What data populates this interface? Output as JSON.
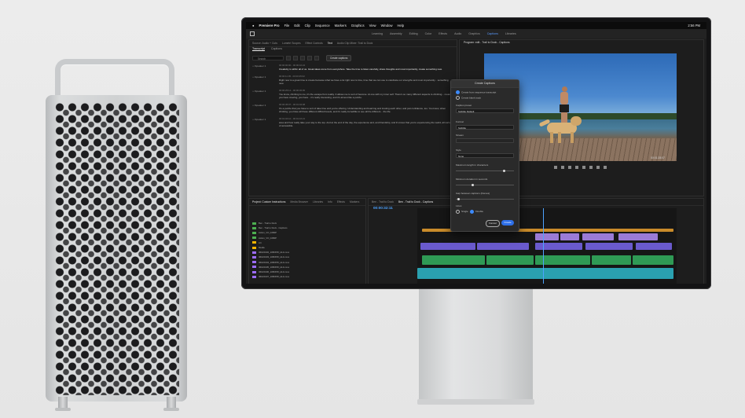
{
  "menubar": {
    "app_name": "Premiere Pro",
    "items": [
      "File",
      "Edit",
      "Clip",
      "Sequence",
      "Markers",
      "Graphics",
      "View",
      "Window",
      "Help"
    ],
    "clock": "2:56 PM"
  },
  "workspaces": [
    "Learning",
    "Assembly",
    "Editing",
    "Color",
    "Effects",
    "Audio",
    "Graphics",
    "Captions",
    "Libraries"
  ],
  "text_panel": {
    "tabs": [
      "Source: Audio + Cuts",
      "Lumetri Scopes",
      "Effect Controls",
      "Text",
      "Audio Clip Mixer: Trail to Dock"
    ],
    "subtabs": [
      "Transcript",
      "Captions"
    ],
    "search_placeholder": "Search",
    "create_captions_label": "Create captions",
    "transcript": [
      {
        "speaker": "Speaker 1",
        "time": "00:00:00:00 - 00:00:10:24",
        "text": "Creativity is within all of us. Great ideas come from everywhere. Take the time to listen carefully, share thoughts and most importantly, create something new."
      },
      {
        "speaker": "Speaker 1",
        "time": "00:00:11:05 - 00:00:25:02",
        "text": "Right now is a great time to create because what we have a lot right now is time, time that we can use to celebrate our strengths and most importantly... something new."
      },
      {
        "speaker": "Speaker 1",
        "time": "00:00:25:12 - 00:00:45:05",
        "text": "You know, climbing to me, it's the escape from reality. It allows me to sort of become. At one with my inner self. There's so many different aspects to climbing... mean, you have crewing, you have... it's really interesting, and it's almost like a puzzle."
      },
      {
        "speaker": "Speaker 1",
        "time": "00:00:45:07 - 00:01:04:08",
        "text": "It's a puzzle that you have to sort of take time and you're offering. Understanding and learning and trusting each other, and just confidence, too. You know, when climbing, you have all these different difficult levels, and it's really incredible to see all the different... the life."
      },
      {
        "speaker": "Speaker 1",
        "time": "00:01:04:10 - 00:01:16:21",
        "text": "area and how really take your way to the top. And at the end of the day, the experience and, and friendship, and it's know that you're experiencing the world, all sorts of accessible."
      }
    ]
  },
  "program_monitor": {
    "title": "Program: edit - Trail to Dock - Captions",
    "timecode": "00:01:28:07",
    "fit": "Fit"
  },
  "project_panel": {
    "tabs": [
      "Project: Custom Instructions",
      "Media Browser",
      "Libraries",
      "Info",
      "Effects",
      "Markers"
    ],
    "rows": [
      {
        "name": "Ben - Trail to Dock",
        "color": "#4caf50"
      },
      {
        "name": "Ben - Trail to Dock - Captions",
        "color": "#4caf50"
      },
      {
        "name": "Action_VO_1080P",
        "color": "#4caf50"
      },
      {
        "name": "Action_VO_1080P",
        "color": "#4caf50"
      },
      {
        "name": "Art",
        "color": "#f4b400"
      },
      {
        "name": "Media",
        "color": "#f4b400"
      },
      {
        "name": "IMG00102_1080P25_HLG.mov",
        "color": "#9c6cff"
      },
      {
        "name": "IMG00103_1080P25_HLG.mov",
        "color": "#9c6cff"
      },
      {
        "name": "IMG00104_1080P25_HLG.mov",
        "color": "#9c6cff"
      },
      {
        "name": "IMG00105_1080P25_HLG.mov",
        "color": "#9c6cff"
      },
      {
        "name": "IMG00106_1080P25_HLG.mov",
        "color": "#9c6cff"
      },
      {
        "name": "IMG00107_1080P25_HLG.mov",
        "color": "#9c6cff"
      }
    ]
  },
  "timeline": {
    "tabs": [
      "Ben - Trail to Dock",
      "Ben - Trail to Dock - Captions"
    ],
    "timecode": "00:00:32:11"
  },
  "create_captions_dialog": {
    "title": "Create Captions",
    "option_from_sequence": "Create from sequence transcript",
    "option_blank": "Create blank track",
    "caption_preset_label": "Caption preset",
    "caption_preset_value": "Subtitle Default",
    "format_label": "Format",
    "format_value": "Subtitle",
    "stream_label": "Stream",
    "style_label": "Style",
    "style_value": "None",
    "max_length_label": "Maximum length in characters",
    "min_duration_label": "Minimum duration in seconds",
    "gap_label": "Gap between captions (frames)",
    "lines_label": "Lines",
    "lines_single": "Single",
    "lines_double": "Double",
    "cancel_label": "Cancel",
    "create_label": "Create"
  }
}
